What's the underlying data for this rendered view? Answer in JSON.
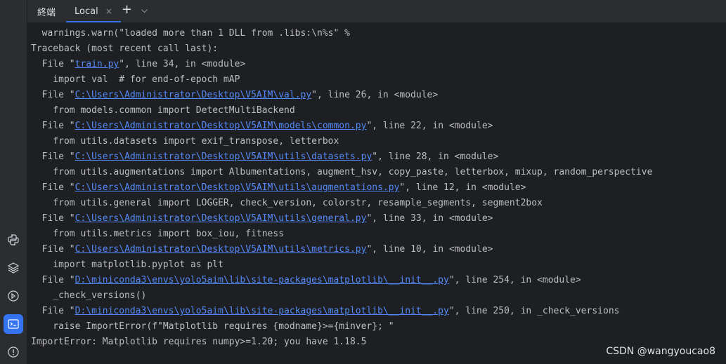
{
  "sidebar": {
    "icons": [
      "python-icon",
      "layers-icon",
      "services-icon",
      "terminal-icon",
      "problems-icon"
    ]
  },
  "tabbar": {
    "title": "終端",
    "tab_label": "Local",
    "close": "×",
    "add": "+",
    "menu": "⌵"
  },
  "terminal": {
    "lines": [
      {
        "parts": [
          {
            "text": "  warnings.warn(\"loaded more than 1 DLL from .libs:\\n%s\" %"
          }
        ]
      },
      {
        "parts": [
          {
            "text": "Traceback (most recent call last):"
          }
        ]
      },
      {
        "parts": [
          {
            "text": "  File \""
          },
          {
            "text": "train.py",
            "link": true
          },
          {
            "text": "\", line 34, in <module>"
          }
        ]
      },
      {
        "parts": [
          {
            "text": "    import val  # for end-of-epoch mAP"
          }
        ]
      },
      {
        "parts": [
          {
            "text": "  File \""
          },
          {
            "text": "C:\\Users\\Administrator\\Desktop\\V5AIM\\val.py",
            "link": true
          },
          {
            "text": "\", line 26, in <module>"
          }
        ]
      },
      {
        "parts": [
          {
            "text": "    from models.common import DetectMultiBackend"
          }
        ]
      },
      {
        "parts": [
          {
            "text": "  File \""
          },
          {
            "text": "C:\\Users\\Administrator\\Desktop\\V5AIM\\models\\common.py",
            "link": true
          },
          {
            "text": "\", line 22, in <module>"
          }
        ]
      },
      {
        "parts": [
          {
            "text": "    from utils.datasets import exif_transpose, letterbox"
          }
        ]
      },
      {
        "parts": [
          {
            "text": "  File \""
          },
          {
            "text": "C:\\Users\\Administrator\\Desktop\\V5AIM\\utils\\datasets.py",
            "link": true
          },
          {
            "text": "\", line 28, in <module>"
          }
        ]
      },
      {
        "parts": [
          {
            "text": "    from utils.augmentations import Albumentations, augment_hsv, copy_paste, letterbox, mixup, random_perspective"
          }
        ]
      },
      {
        "parts": [
          {
            "text": "  File \""
          },
          {
            "text": "C:\\Users\\Administrator\\Desktop\\V5AIM\\utils\\augmentations.py",
            "link": true
          },
          {
            "text": "\", line 12, in <module>"
          }
        ]
      },
      {
        "parts": [
          {
            "text": "    from utils.general import LOGGER, check_version, colorstr, resample_segments, segment2box"
          }
        ]
      },
      {
        "parts": [
          {
            "text": "  File \""
          },
          {
            "text": "C:\\Users\\Administrator\\Desktop\\V5AIM\\utils\\general.py",
            "link": true
          },
          {
            "text": "\", line 33, in <module>"
          }
        ]
      },
      {
        "parts": [
          {
            "text": "    from utils.metrics import box_iou, fitness"
          }
        ]
      },
      {
        "parts": [
          {
            "text": "  File \""
          },
          {
            "text": "C:\\Users\\Administrator\\Desktop\\V5AIM\\utils\\metrics.py",
            "link": true
          },
          {
            "text": "\", line 10, in <module>"
          }
        ]
      },
      {
        "parts": [
          {
            "text": "    import matplotlib.pyplot as plt"
          }
        ]
      },
      {
        "parts": [
          {
            "text": "  File \""
          },
          {
            "text": "D:\\miniconda3\\envs\\yolo5aim\\lib\\site-packages\\matplotlib\\__init__.py",
            "link": true
          },
          {
            "text": "\", line 254, in <module>"
          }
        ]
      },
      {
        "parts": [
          {
            "text": "    _check_versions()"
          }
        ]
      },
      {
        "parts": [
          {
            "text": "  File \""
          },
          {
            "text": "D:\\miniconda3\\envs\\yolo5aim\\lib\\site-packages\\matplotlib\\__init__.py",
            "link": true
          },
          {
            "text": "\", line 250, in _check_versions"
          }
        ]
      },
      {
        "parts": [
          {
            "text": "    raise ImportError(f\"Matplotlib requires {modname}>={minver}; \""
          }
        ]
      },
      {
        "parts": [
          {
            "text": "ImportError: Matplotlib requires numpy>=1.20; you have 1.18.5"
          }
        ]
      }
    ]
  },
  "watermark": "CSDN @wangyoucao8",
  "colors": {
    "background": "#1e1f22",
    "panel": "#2b2d30",
    "text": "#bcbec4",
    "link": "#548af7",
    "accent": "#3574f0"
  }
}
